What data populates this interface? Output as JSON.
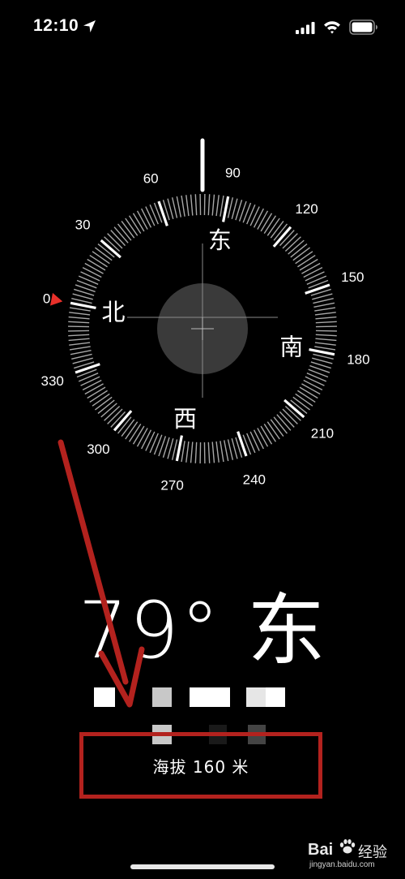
{
  "status_bar": {
    "time": "12:10",
    "icons": [
      "location-arrow-icon",
      "cellular-signal-icon",
      "wifi-icon",
      "battery-icon"
    ]
  },
  "compass": {
    "heading_degrees": 79,
    "bezel_labels": [
      {
        "deg": 0,
        "text": "0"
      },
      {
        "deg": 30,
        "text": "30"
      },
      {
        "deg": 60,
        "text": "60"
      },
      {
        "deg": 90,
        "text": "90"
      },
      {
        "deg": 120,
        "text": "120"
      },
      {
        "deg": 150,
        "text": "150"
      },
      {
        "deg": 180,
        "text": "180"
      },
      {
        "deg": 210,
        "text": "210"
      },
      {
        "deg": 240,
        "text": "240"
      },
      {
        "deg": 270,
        "text": "270"
      },
      {
        "deg": 300,
        "text": "300"
      },
      {
        "deg": 330,
        "text": "330"
      }
    ],
    "cardinals": [
      {
        "deg": 0,
        "text": "北"
      },
      {
        "deg": 90,
        "text": "东"
      },
      {
        "deg": 180,
        "text": "南"
      },
      {
        "deg": 270,
        "text": "西"
      }
    ]
  },
  "heading_text": "79° 东",
  "altitude_text": "海拔 160 米",
  "watermark": {
    "brand": "Bai",
    "brand_cn": "经验",
    "url": "jingyan.baidu.com"
  },
  "colors": {
    "annotation_red": "#b3221e",
    "north_marker": "#e8302a",
    "background": "#000000"
  }
}
